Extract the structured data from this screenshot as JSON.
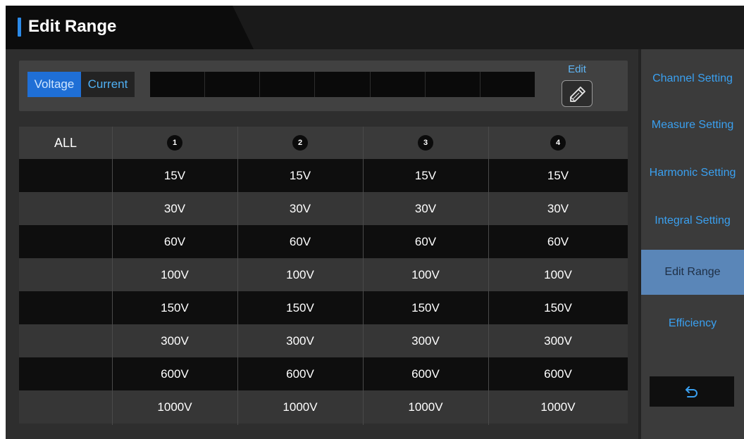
{
  "header": {
    "title": "Edit Range"
  },
  "mode": {
    "voltage_label": "Voltage",
    "current_label": "Current",
    "selected": "Voltage"
  },
  "edit": {
    "label": "Edit",
    "icon": "pencil-icon"
  },
  "table": {
    "all_label": "ALL",
    "channels": [
      "1",
      "2",
      "3",
      "4"
    ],
    "rows": [
      [
        "15V",
        "15V",
        "15V",
        "15V"
      ],
      [
        "30V",
        "30V",
        "30V",
        "30V"
      ],
      [
        "60V",
        "60V",
        "60V",
        "60V"
      ],
      [
        "100V",
        "100V",
        "100V",
        "100V"
      ],
      [
        "150V",
        "150V",
        "150V",
        "150V"
      ],
      [
        "300V",
        "300V",
        "300V",
        "300V"
      ],
      [
        "600V",
        "600V",
        "600V",
        "600V"
      ],
      [
        "1000V",
        "1000V",
        "1000V",
        "1000V"
      ]
    ]
  },
  "sidebar": {
    "items": [
      {
        "label": "Channel Setting"
      },
      {
        "label": "Measure Setting"
      },
      {
        "label": "Harmonic Setting"
      },
      {
        "label": "Integral Setting"
      },
      {
        "label": "Edit Range"
      },
      {
        "label": "Efficiency"
      }
    ],
    "active": "Edit Range",
    "back_icon": "back-arrow-icon"
  },
  "colors": {
    "accent": "#2b8ae8",
    "sidebar_text": "#3aa0f0",
    "sidebar_active_bg": "#5a86b8",
    "mode_active_bg": "#1f6fd6"
  }
}
